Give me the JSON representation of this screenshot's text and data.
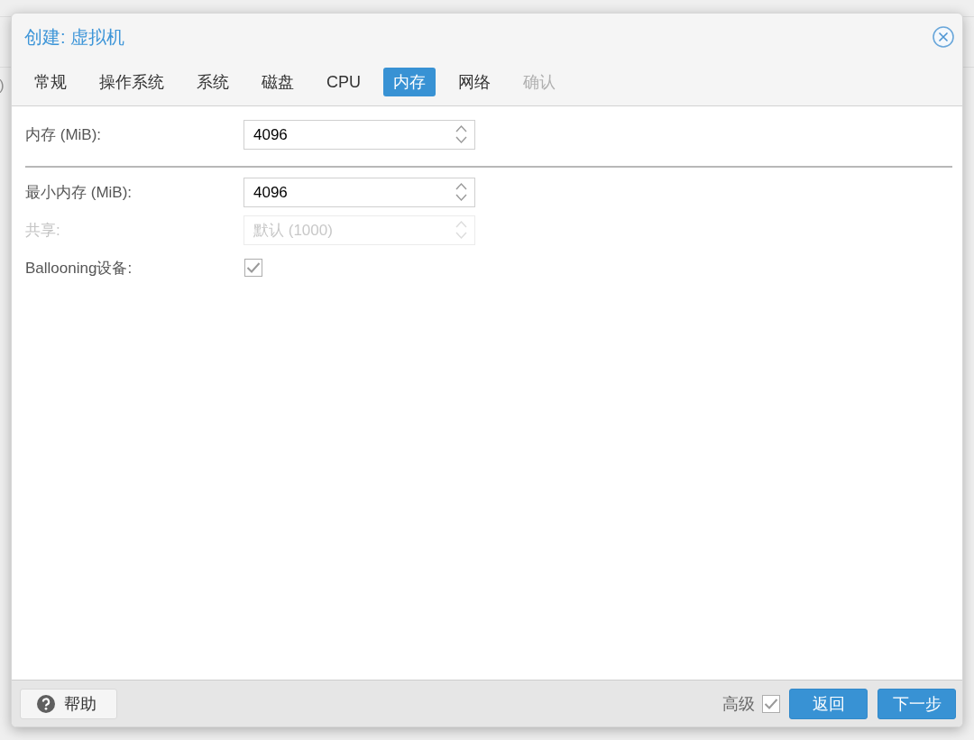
{
  "background": {
    "fragments": [
      ")"
    ]
  },
  "dialog": {
    "title": "创建: 虚拟机",
    "tabs": [
      {
        "label": "常规",
        "selected": false,
        "disabled": false
      },
      {
        "label": "操作系统",
        "selected": false,
        "disabled": false
      },
      {
        "label": "系统",
        "selected": false,
        "disabled": false
      },
      {
        "label": "磁盘",
        "selected": false,
        "disabled": false
      },
      {
        "label": "CPU",
        "selected": false,
        "disabled": false
      },
      {
        "label": "内存",
        "selected": true,
        "disabled": false
      },
      {
        "label": "网络",
        "selected": false,
        "disabled": false
      },
      {
        "label": "确认",
        "selected": false,
        "disabled": true
      }
    ],
    "sections": [
      {
        "fields": [
          {
            "kind": "spinner",
            "label": "内存 (MiB):",
            "value": "4096",
            "disabled": false
          }
        ]
      },
      {
        "fields": [
          {
            "kind": "spinner",
            "label": "最小内存 (MiB):",
            "value": "4096",
            "disabled": false
          },
          {
            "kind": "spinner",
            "label": "共享:",
            "placeholder": "默认 (1000)",
            "disabled": true
          },
          {
            "kind": "checkbox",
            "label": "Ballooning设备:",
            "checked": true,
            "disabled": false
          }
        ]
      }
    ],
    "footer": {
      "help_button": {
        "label": "帮助"
      },
      "advanced": {
        "label": "高级",
        "checked": true
      },
      "buttons": [
        {
          "label": "返回"
        },
        {
          "label": "下一步"
        }
      ]
    }
  }
}
